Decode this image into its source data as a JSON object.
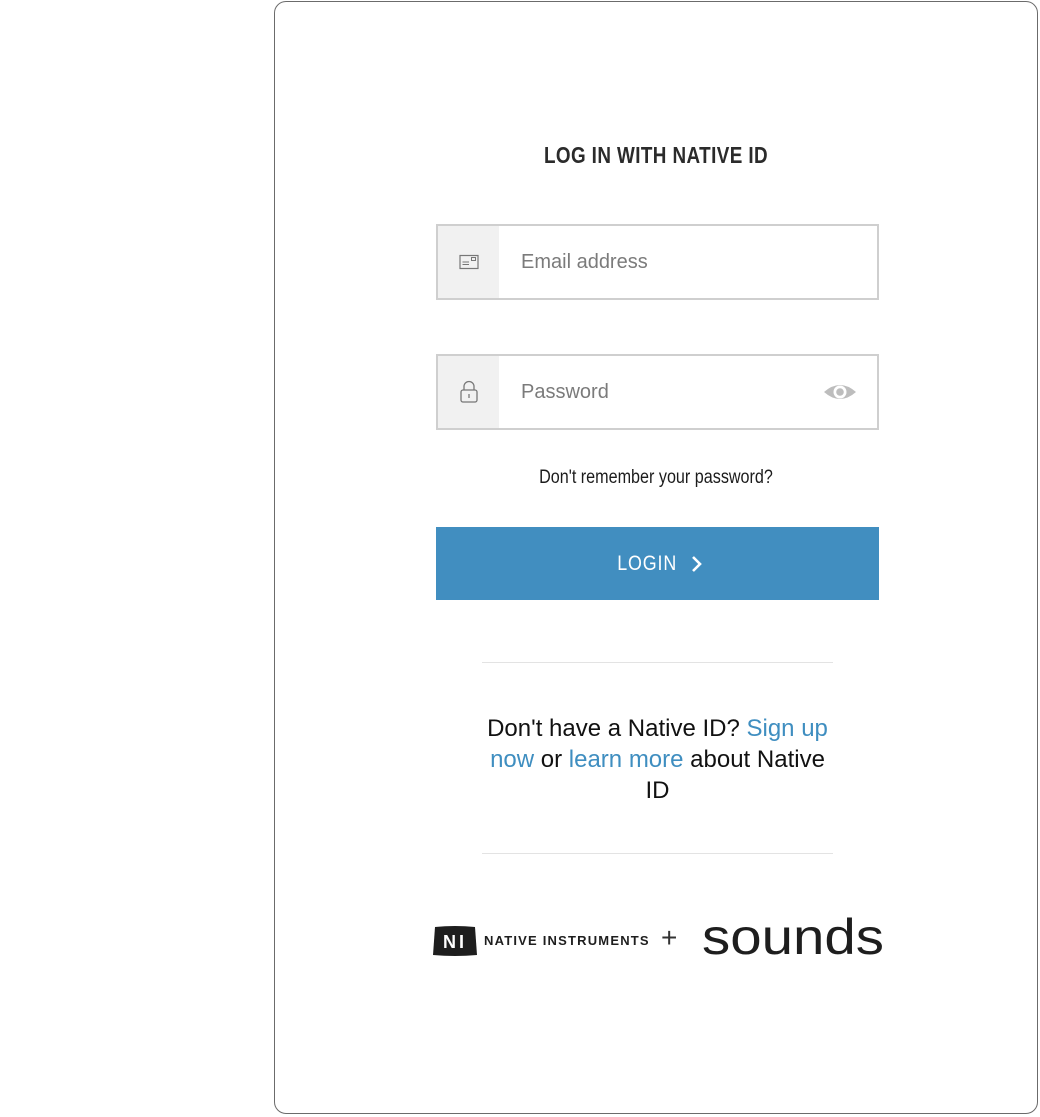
{
  "login": {
    "title": "LOG IN WITH NATIVE ID",
    "email_placeholder": "Email address",
    "password_placeholder": "Password",
    "forgot_password": "Don't remember your password?",
    "login_button": "LOGIN",
    "signup_prefix": "Don't have a Native ID? ",
    "signup_link": "Sign up now",
    "signup_middle": " or ",
    "learn_more_link": "learn more",
    "signup_suffix": " about Native ID"
  },
  "branding": {
    "ni_name": "NATIVE INSTRUMENTS",
    "ni_mark": "NI",
    "plus": "+",
    "sounds_name": "sounds"
  },
  "colors": {
    "accent": "#418ec0",
    "link": "#3f8ec0",
    "icon_box": "#f1f1f1",
    "border": "#cfcfcf"
  },
  "icons": {
    "email": "envelope-icon",
    "password": "lock-icon",
    "reveal": "eye-icon",
    "button_arrow": "chevron-right-icon"
  }
}
